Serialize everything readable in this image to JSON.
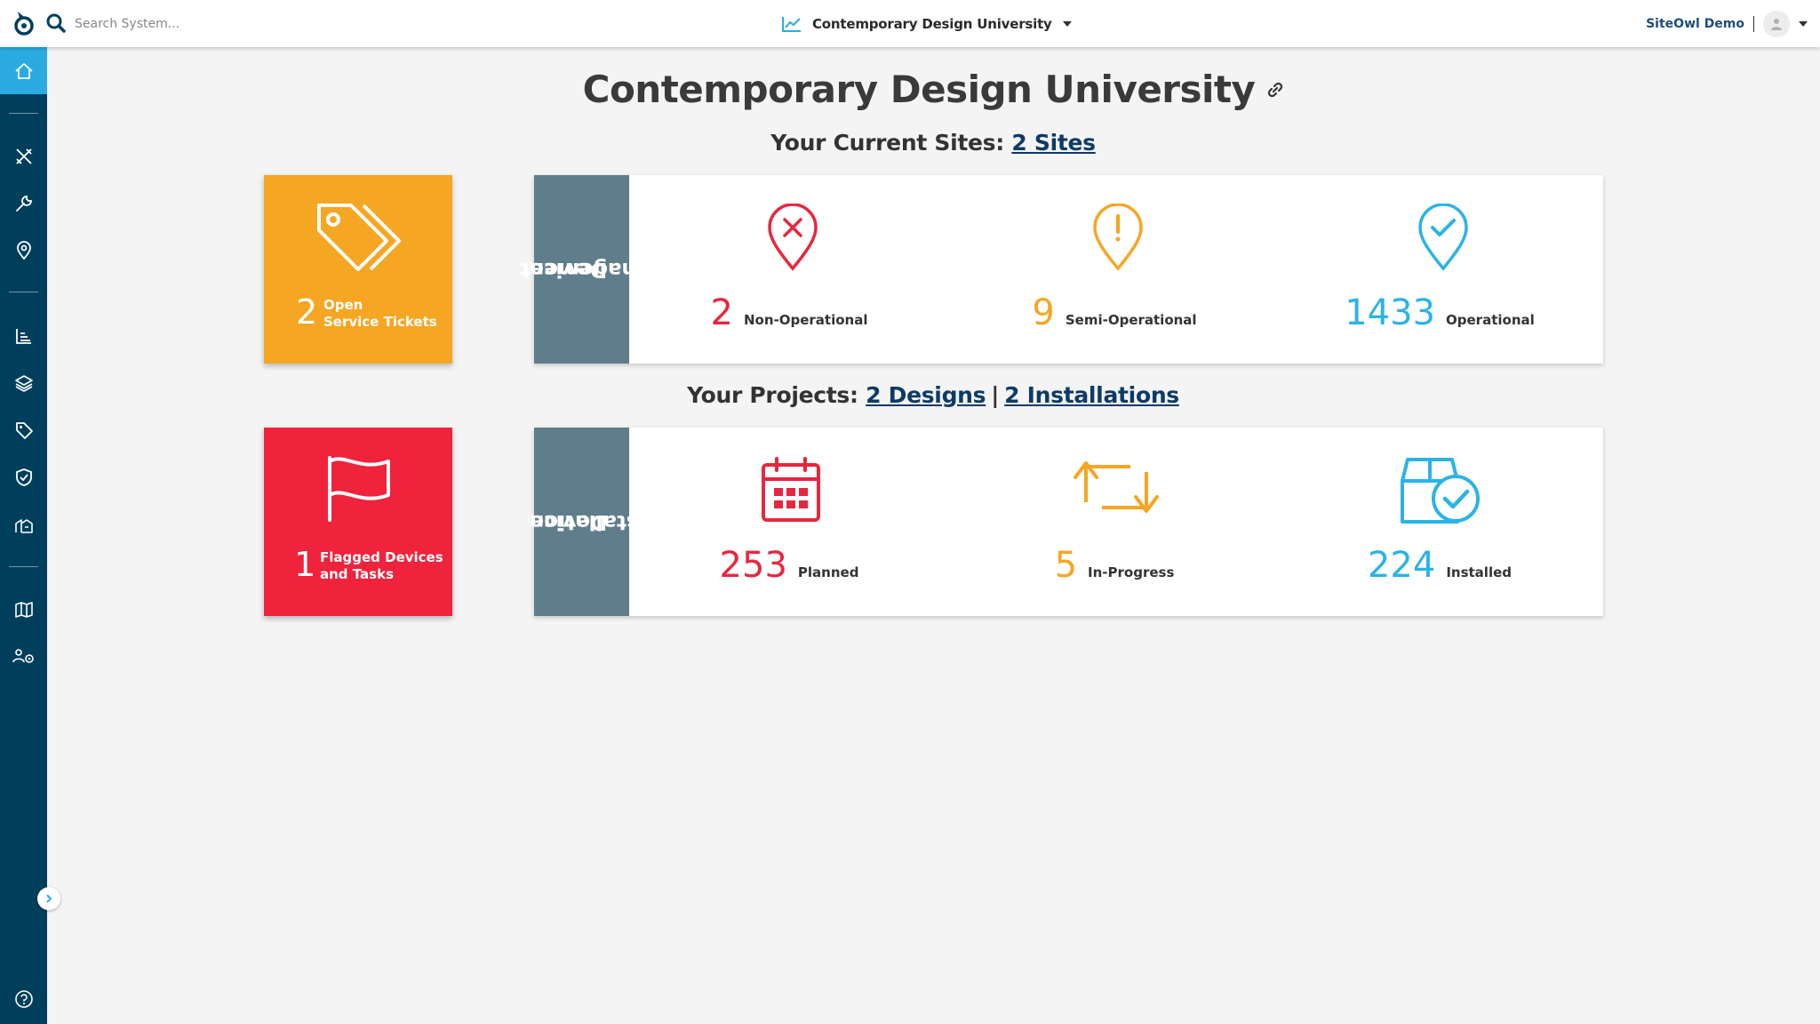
{
  "header": {
    "search_placeholder": "Search System...",
    "org_name": "Contemporary Design University",
    "user_name": "SiteOwl Demo"
  },
  "sidebar": {
    "items": [
      "home-icon",
      "design-tools-icon",
      "wrench-icon",
      "location-pin-icon",
      "reports-icon",
      "layers-icon",
      "tag-icon",
      "shield-check-icon",
      "inventory-icon",
      "map-icon",
      "team-settings-icon"
    ],
    "help_icon": "help-icon",
    "active_item": "home-icon"
  },
  "main": {
    "title": "Contemporary Design University",
    "sites_prefix": "Your Current Sites:",
    "sites_link": "2 Sites",
    "projects_prefix": "Your Projects:",
    "designs_link": "2 Designs",
    "pipe": "|",
    "installations_link": "2 Installations"
  },
  "tiles": {
    "tickets": {
      "count": "2",
      "label_line1": "Open",
      "label_line2": "Service Tickets",
      "color": "#f5a623"
    },
    "flagged": {
      "count": "1",
      "label_line1": "Flagged Devices",
      "label_line2": "and Tasks",
      "color": "#ef233c"
    }
  },
  "device_management": {
    "title_line1": "Device",
    "title_line2": "Management",
    "stats": [
      {
        "value": "2",
        "label": "Non-Operational",
        "color": "#e8263f"
      },
      {
        "value": "9",
        "label": "Semi-Operational",
        "color": "#f5a623"
      },
      {
        "value": "1433",
        "label": "Operational",
        "color": "#2bb3e6"
      }
    ]
  },
  "device_installation": {
    "title_line1": "Device",
    "title_line2": "Installation",
    "stats": [
      {
        "value": "253",
        "label": "Planned",
        "color": "#e8263f"
      },
      {
        "value": "5",
        "label": "In-Progress",
        "color": "#f5a623"
      },
      {
        "value": "224",
        "label": "Installed",
        "color": "#2bb3e6"
      }
    ]
  }
}
